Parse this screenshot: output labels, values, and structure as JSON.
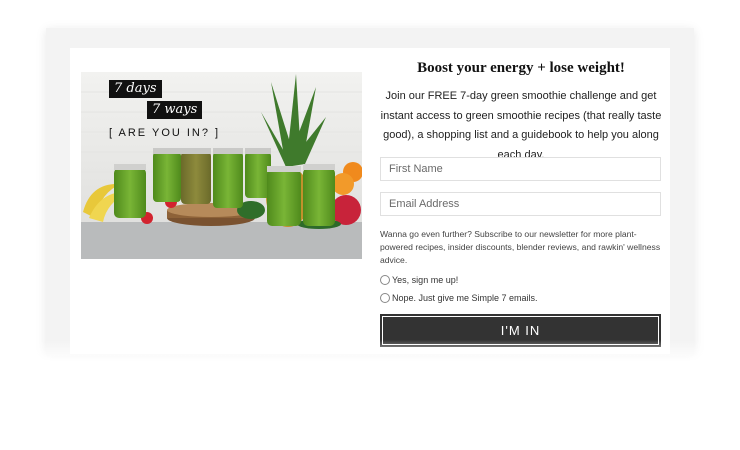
{
  "hero": {
    "tag_days": "7 days",
    "tag_ways": "7 ways",
    "tag_question": "[ ARE YOU IN? ]"
  },
  "optin": {
    "title": "Boost your energy + lose weight!",
    "description": "Join our FREE 7-day green smoothie challenge and get instant access to green smoothie recipes (that really taste good), a shopping list and a guidebook to help you along each day.",
    "first_name_placeholder": "First Name",
    "email_placeholder": "Email Address",
    "newsletter_text": "Wanna go even further? Subscribe to our newsletter for more plant-powered recipes, insider discounts, blender reviews, and rawkin' wellness advice.",
    "option_yes": "Yes, sign me up!",
    "option_no": "Nope. Just give me Simple 7 emails.",
    "submit_label": "I'M IN"
  },
  "colors": {
    "button_bg": "#333333",
    "frame_bg": "#f3f3f3",
    "smoothie_green": "#6aa52a"
  }
}
